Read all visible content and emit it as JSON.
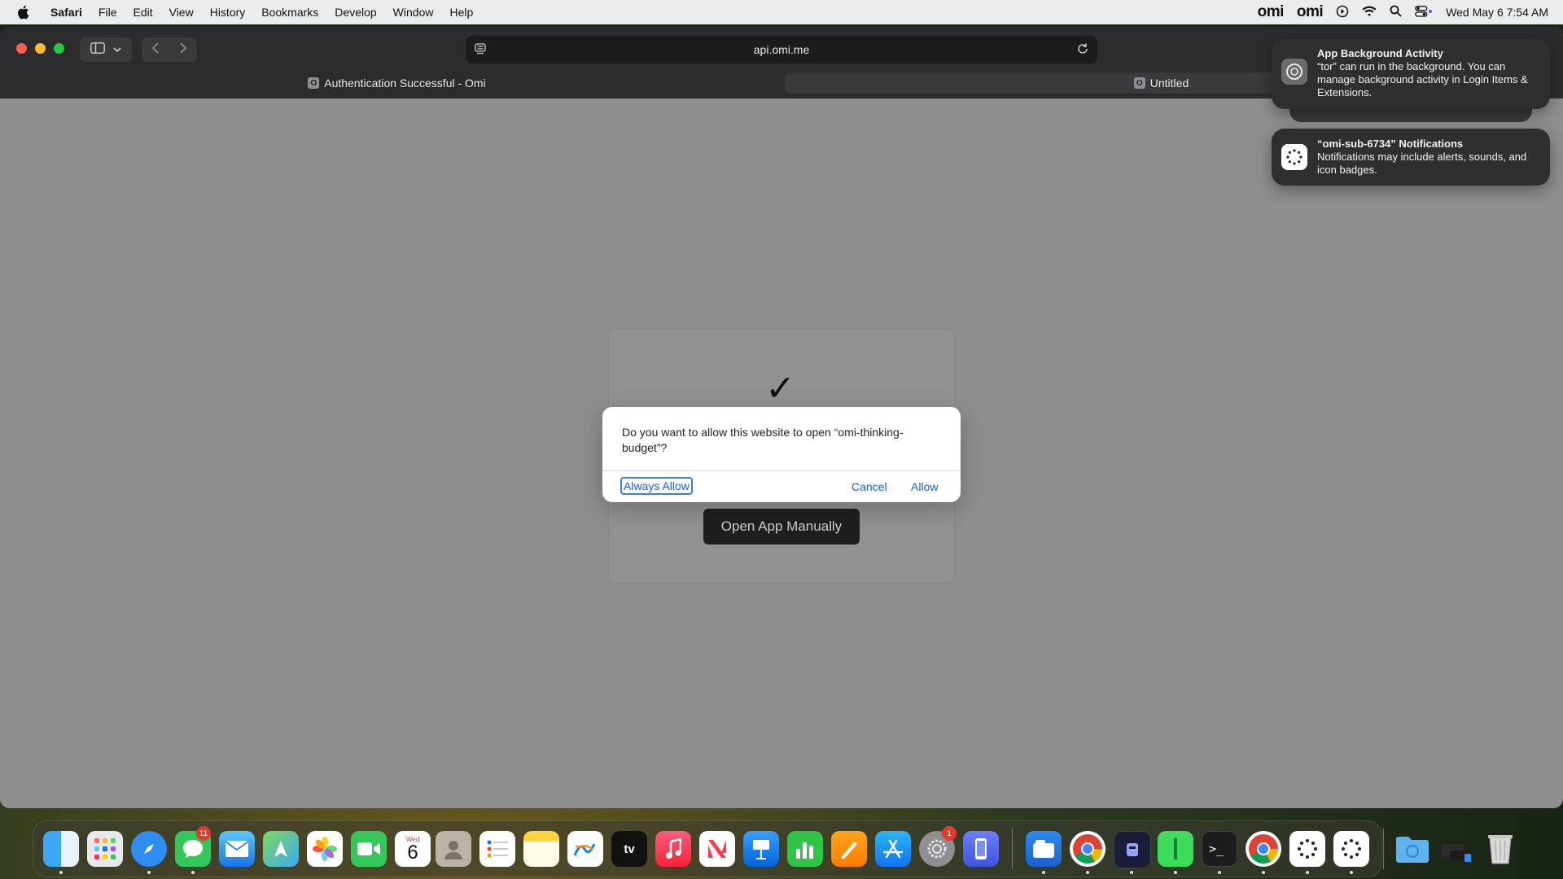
{
  "menubar": {
    "items": [
      "Safari",
      "File",
      "Edit",
      "View",
      "History",
      "Bookmarks",
      "Develop",
      "Window",
      "Help"
    ],
    "status_omi_1": "omi",
    "status_omi_2": "omi",
    "clock": "Wed May 6  7:54 AM"
  },
  "browser": {
    "url": "api.omi.me",
    "tabs": [
      {
        "label": "Authentication Successful - Omi",
        "favicon": "O"
      },
      {
        "label": "Untitled",
        "favicon": "O"
      }
    ]
  },
  "page": {
    "check_glyph": "✓",
    "open_app_button": "Open App Manually"
  },
  "dialog": {
    "message": "Do you want to allow this website to open “omi-thinking-budget”?",
    "always_allow": "Always Allow",
    "cancel": "Cancel",
    "allow": "Allow"
  },
  "notifications": [
    {
      "title": "App Background Activity",
      "body": "“tor” can run in the background. You can manage background activity in Login Items & Extensions.",
      "icon": "gear-icon"
    },
    {
      "title": "“omi-sub-6734” Notifications",
      "body": "Notifications may include alerts, sounds, and icon badges.",
      "icon": "dots-icon"
    }
  ],
  "dock": {
    "calendar_month": "Wed",
    "calendar_day": "6",
    "messages_badge": "11",
    "settings_badge": "1",
    "apps": [
      "finder",
      "launchpad",
      "safari",
      "messages",
      "mail",
      "maps",
      "photos",
      "facetime",
      "calendar",
      "contacts",
      "reminders",
      "notes",
      "freeform",
      "tv",
      "music",
      "news",
      "keynote",
      "numbers",
      "pages",
      "app-store",
      "system-settings",
      "iphone-mirroring",
      "files",
      "chrome",
      "omi-app",
      "android-file",
      "terminal",
      "chrome-2",
      "omi-dots-1",
      "omi-dots-2",
      "downloads",
      "trash"
    ]
  }
}
